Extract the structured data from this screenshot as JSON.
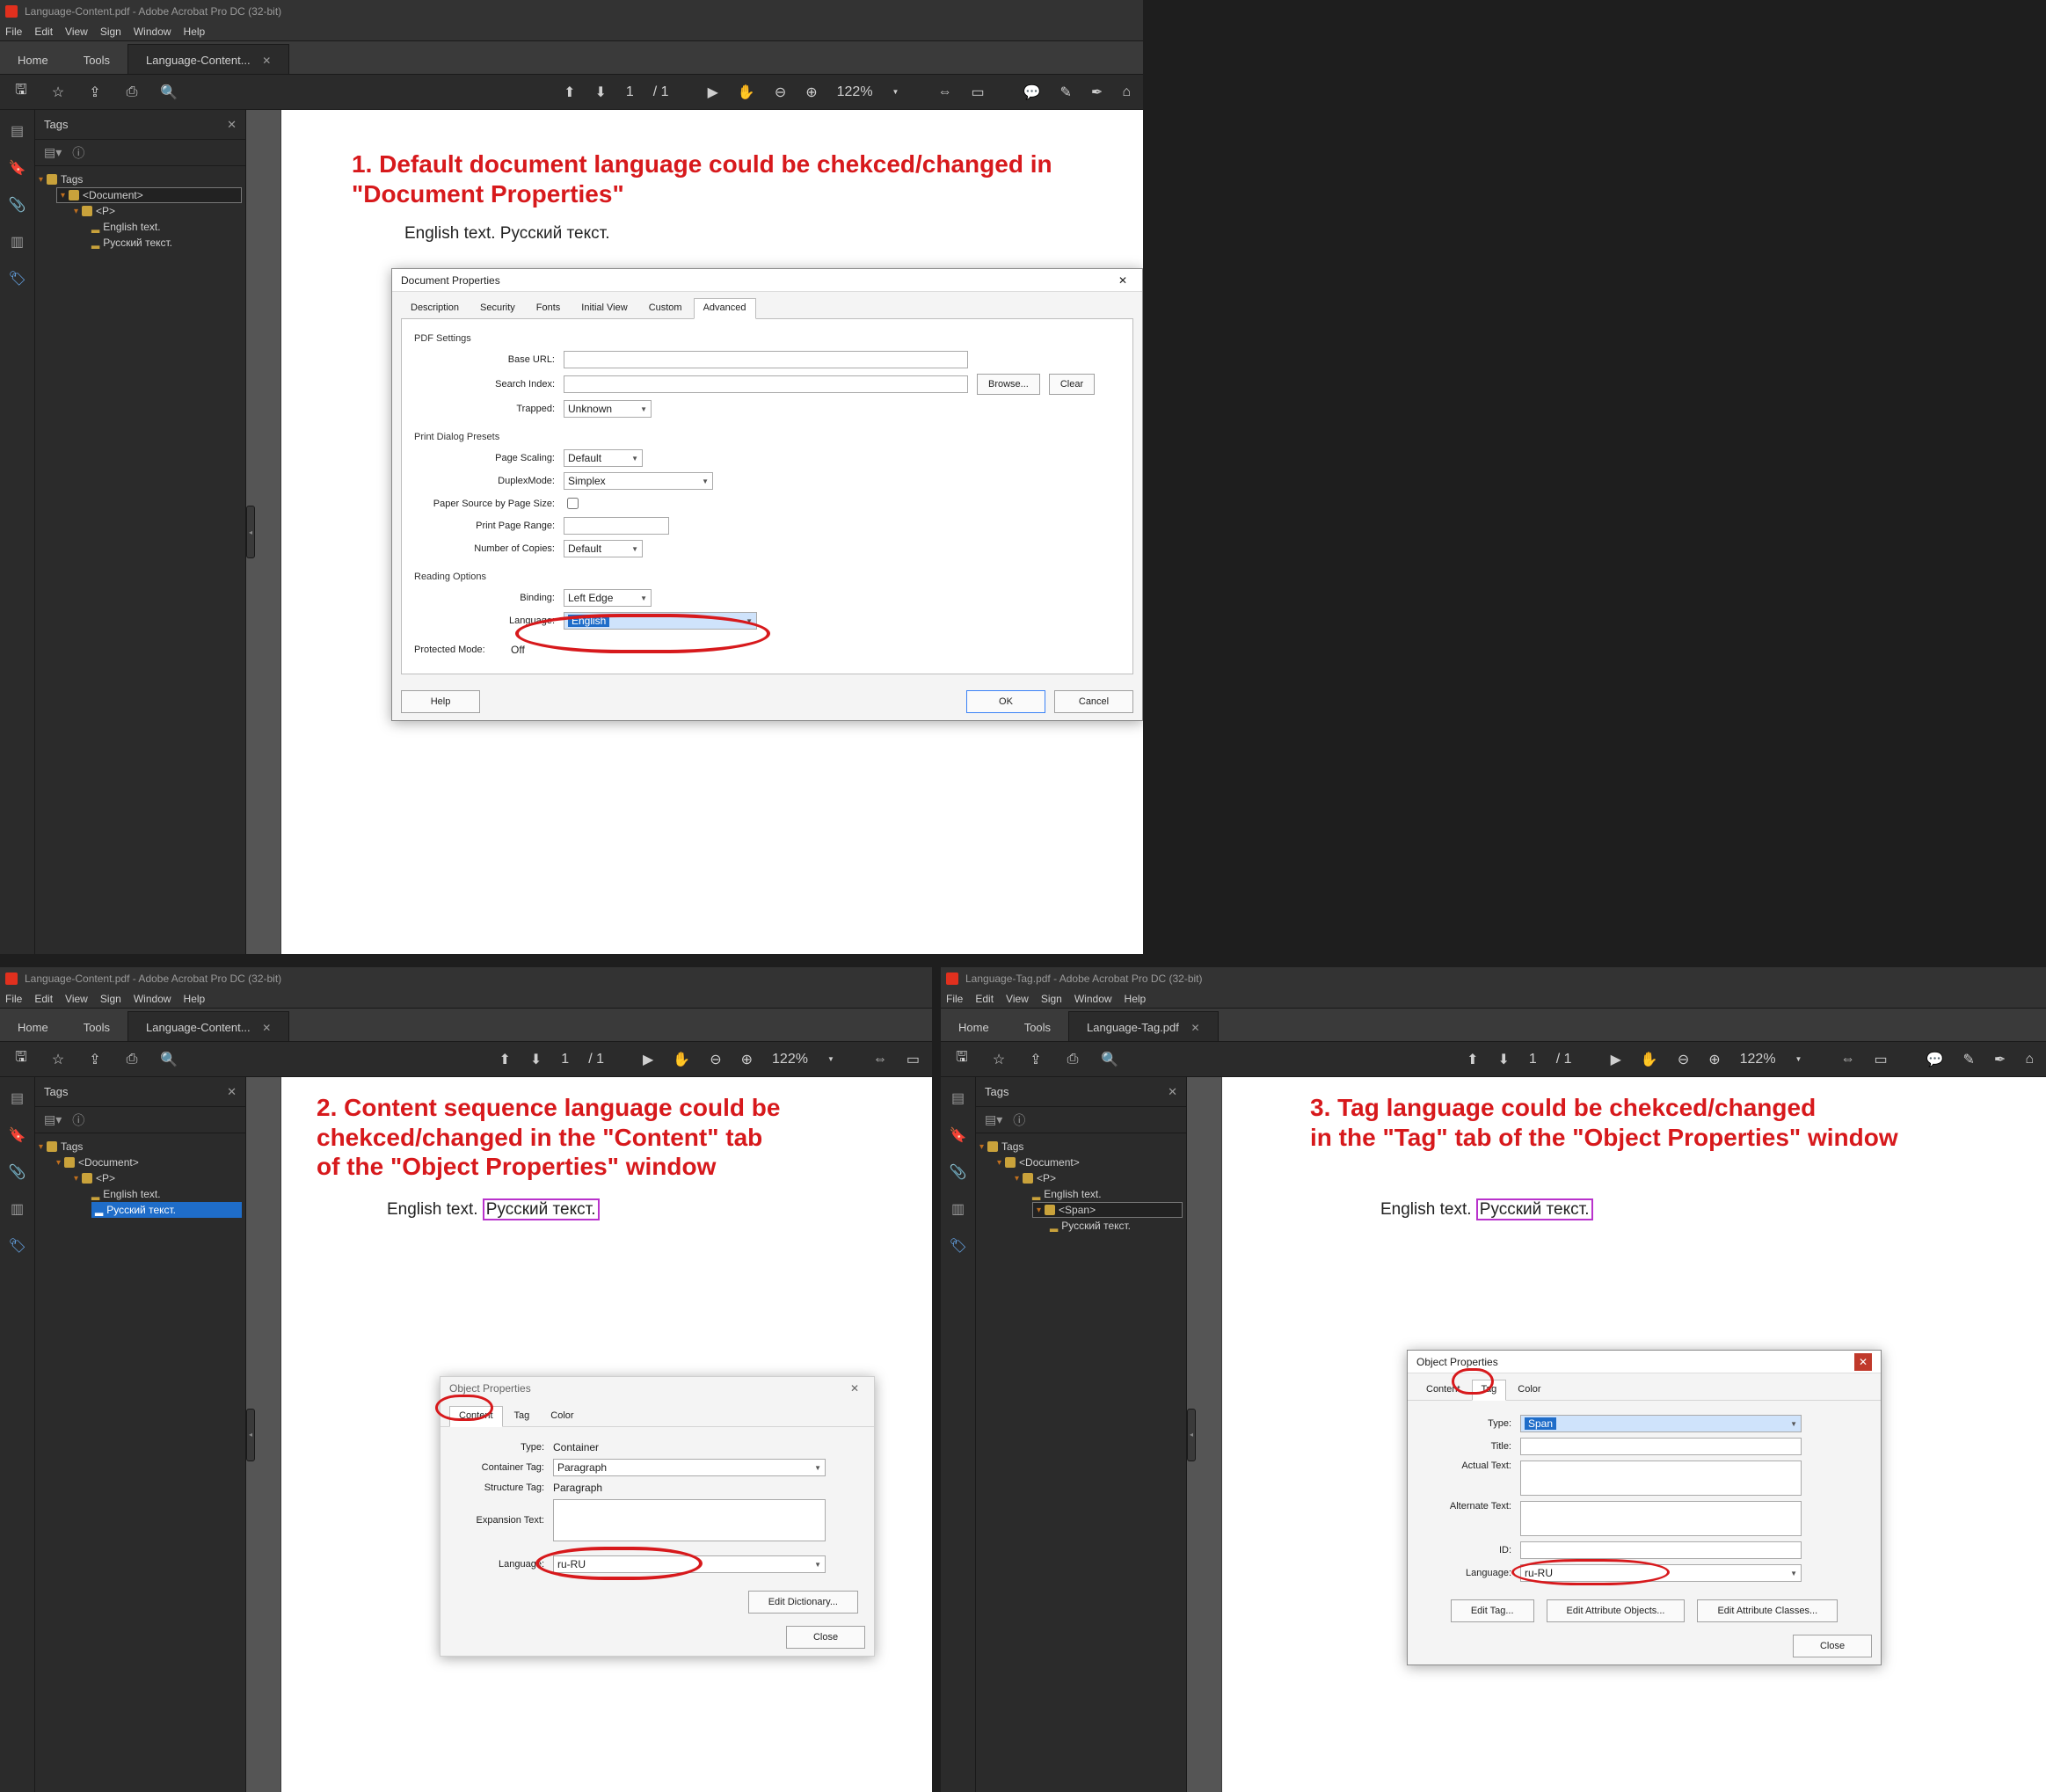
{
  "captions": {
    "c1": "1. Default document language could be chekced/changed in \"Document Properties\"",
    "c2": "2. Content sequence language could be chekced/changed in the \"Content\" tab\nof the \"Object Properties\" window",
    "c3": "3. Tag language could be chekced/changed\nin the \"Tag\" tab of the \"Object Properties\" window"
  },
  "sample_text": {
    "en": "English text.",
    "ru": "Русский текст."
  },
  "acrobat": {
    "titleA": "Language-Content.pdf - Adobe Acrobat Pro DC (32-bit)",
    "titleB": "Language-Content.pdf - Adobe Acrobat Pro DC (32-bit)",
    "titleC": "Language-Tag.pdf - Adobe Acrobat Pro DC (32-bit)",
    "menus": [
      "File",
      "Edit",
      "View",
      "Sign",
      "Window",
      "Help"
    ],
    "home": "Home",
    "tools": "Tools",
    "doctabA": "Language-Content...",
    "doctabC": "Language-Tag.pdf",
    "page_of": "/ 1",
    "page_cur": "1",
    "zoom": "122%",
    "tags_panel": "Tags"
  },
  "tree_top": {
    "root": "Tags",
    "doc": "<Document>",
    "p": "<P>",
    "span": "<Span>",
    "t1": "English text.",
    "t2": "Русский текст."
  },
  "docprops": {
    "title": "Document Properties",
    "tabs": [
      "Description",
      "Security",
      "Fonts",
      "Initial View",
      "Custom",
      "Advanced"
    ],
    "active_tab": "Advanced",
    "grp_pdf": "PDF Settings",
    "base_url": "Base URL:",
    "search_index": "Search Index:",
    "browse": "Browse...",
    "clear": "Clear",
    "trapped": "Trapped:",
    "trapped_val": "Unknown",
    "grp_print": "Print Dialog Presets",
    "page_scaling": "Page Scaling:",
    "page_scaling_val": "Default",
    "duplex": "DuplexMode:",
    "duplex_val": "Simplex",
    "paper_src": "Paper Source by Page Size:",
    "print_range": "Print Page Range:",
    "copies": "Number of Copies:",
    "copies_val": "Default",
    "grp_reading": "Reading Options",
    "binding": "Binding:",
    "binding_val": "Left Edge",
    "language": "Language:",
    "language_val": "English",
    "protectedmode": "Protected Mode:",
    "protectedmode_val": "Off",
    "help": "Help",
    "ok": "OK",
    "cancel": "Cancel"
  },
  "objprops_content": {
    "title": "Object Properties",
    "tabs": [
      "Content",
      "Tag",
      "Color"
    ],
    "active": "Content",
    "type_l": "Type:",
    "type_v": "Container",
    "ctag_l": "Container Tag:",
    "ctag_v": "Paragraph",
    "stag_l": "Structure Tag:",
    "stag_v": "Paragraph",
    "exp_l": "Expansion Text:",
    "lang_l": "Language:",
    "lang_v": "ru-RU",
    "editdict": "Edit Dictionary...",
    "close": "Close"
  },
  "objprops_tag": {
    "title": "Object Properties",
    "tabs": [
      "Content",
      "Tag",
      "Color"
    ],
    "active": "Tag",
    "type_l": "Type:",
    "type_v": "Span",
    "title_l": "Title:",
    "actual_l": "Actual Text:",
    "alt_l": "Alternate Text:",
    "id_l": "ID:",
    "lang_l": "Language:",
    "lang_v": "ru-RU",
    "edit_tag": "Edit Tag...",
    "edit_attr_obj": "Edit Attribute Objects...",
    "edit_attr_cls": "Edit Attribute Classes...",
    "close": "Close"
  }
}
